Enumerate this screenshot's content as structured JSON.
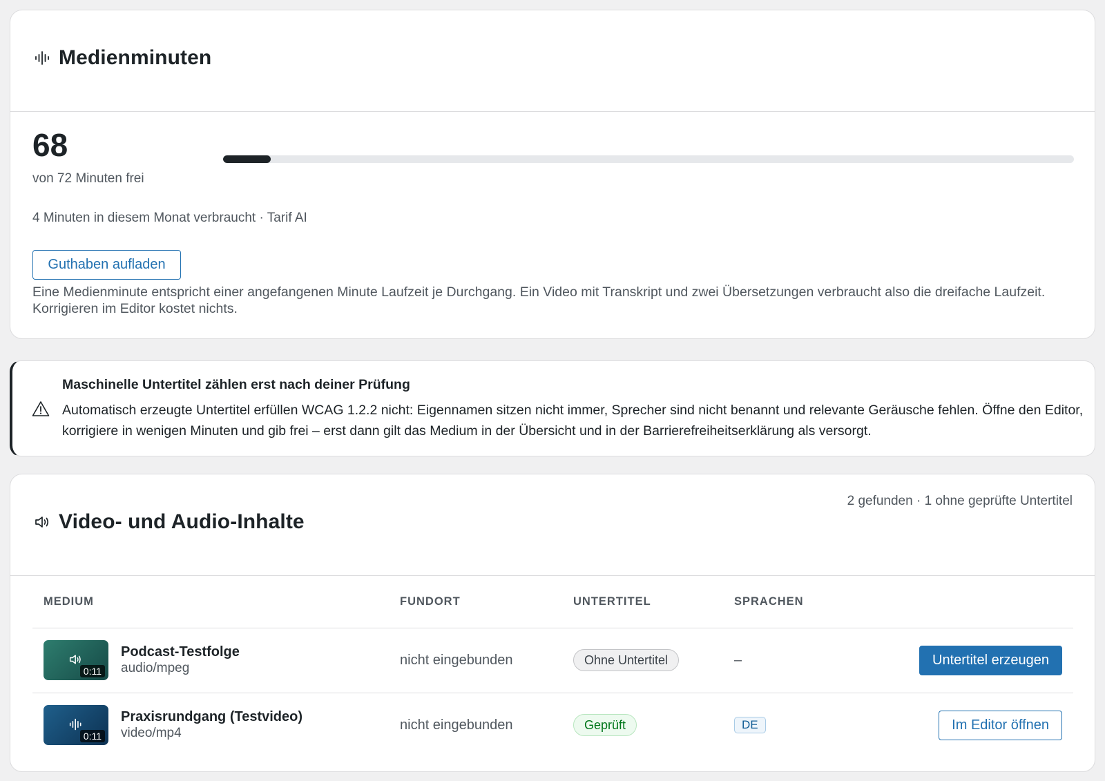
{
  "minutes_card": {
    "title": "Medienminuten",
    "icon": "waveform-icon",
    "free_minutes": "68",
    "free_label": "von 72 Minuten frei",
    "progress_fraction": 0.056,
    "usage_line": "4 Minuten in diesem Monat verbraucht · Tarif AI",
    "topup_label": "Guthaben aufladen",
    "info_text": "Eine Medienminute entspricht einer angefangenen Minute Laufzeit je Durchgang. Ein Video mit Transkript und zwei Übersetzungen verbraucht also die dreifache Laufzeit. Korrigieren im Editor kostet nichts."
  },
  "notice": {
    "icon": "warning-icon",
    "title": "Maschinelle Untertitel zählen erst nach deiner Prüfung",
    "text": "Automatisch erzeugte Untertitel erfüllen WCAG 1.2.2 nicht: Eigennamen sitzen nicht immer, Sprecher sind nicht benannt und relevante Geräusche fehlen. Öffne den Editor, korrigiere in wenigen Minuten und gib frei – erst dann gilt das Medium in der Übersicht und in der Barrierefreiheitserklärung als versorgt."
  },
  "media_card": {
    "title": "Video- und Audio-Inhalte",
    "icon": "speaker-icon",
    "meta": "2 gefunden · 1 ohne geprüfte Untertitel",
    "columns": {
      "medium": "MEDIUM",
      "location": "FUNDORT",
      "subtitles": "UNTERTITEL",
      "languages": "SPRACHEN"
    },
    "rows": [
      {
        "name": "Podcast-Testfolge",
        "type": "audio/mpeg",
        "duration": "0:11",
        "thumb_icon": "speaker-icon",
        "location": "nicht eingebunden",
        "subtitle_status": "Ohne Untertitel",
        "languages": "–",
        "action": "Untertitel erzeugen"
      },
      {
        "name": "Praxisrundgang (Testvideo)",
        "type": "video/mp4",
        "duration": "0:11",
        "thumb_icon": "waveform-icon",
        "location": "nicht eingebunden",
        "subtitle_status": "Geprüft",
        "languages": "DE",
        "action": "Im Editor öffnen"
      }
    ]
  },
  "colors": {
    "accent": "#2271b1",
    "text": "#1d2327",
    "muted": "#50575e",
    "success": "#00761a"
  }
}
